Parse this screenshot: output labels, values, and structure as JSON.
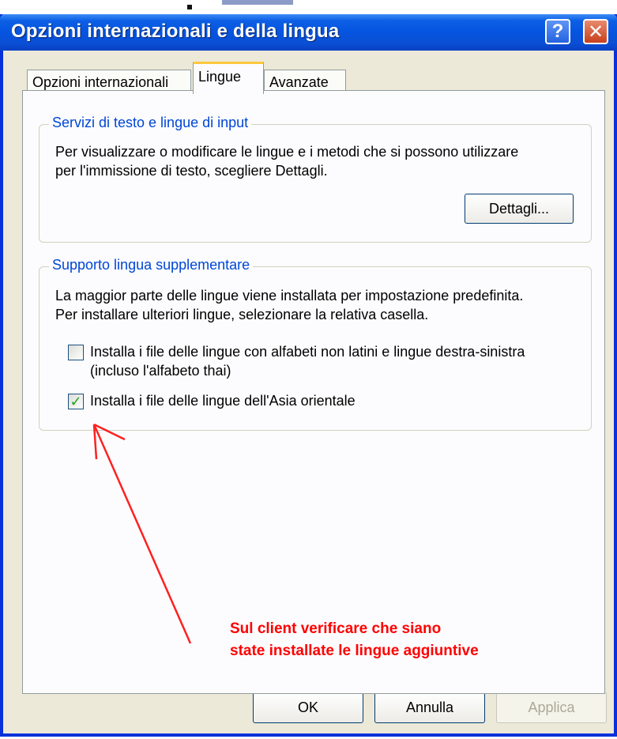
{
  "window": {
    "title": "Opzioni internazionali e della lingua",
    "help_glyph": "?",
    "close_glyph": "✕"
  },
  "tabs": [
    {
      "label": "Opzioni internazionali",
      "active": false
    },
    {
      "label": "Lingue",
      "active": true
    },
    {
      "label": "Avanzate",
      "active": false
    }
  ],
  "group1": {
    "legend": "Servizi di testo e lingue di input",
    "text_line1": "Per visualizzare o modificare le lingue e i metodi che si possono utilizzare",
    "text_line2": "per l'immissione di testo, scegliere Dettagli.",
    "details_button": "Dettagli..."
  },
  "group2": {
    "legend": "Supporto lingua supplementare",
    "text_line1": "La maggior parte delle lingue viene installata per impostazione predefinita.",
    "text_line2": "Per installare ulteriori lingue, selezionare la relativa casella.",
    "checkbox1_line1": "Installa i file delle lingue con alfabeti non latini e lingue destra-sinistra",
    "checkbox1_line2": "(incluso l'alfabeto thai)",
    "checkbox1_checked": false,
    "checkbox2_label": "Installa i file delle lingue dell'Asia orientale",
    "checkbox2_checked": true,
    "check_glyph": "✓"
  },
  "annotation": {
    "line1": "Sul client verificare che siano",
    "line2": "state installate le lingue aggiuntive",
    "color": "#ff0000"
  },
  "buttons": {
    "ok": "OK",
    "cancel": "Annulla",
    "apply": "Applica"
  },
  "colors": {
    "titlebar": "#0654e0",
    "dialog_bg": "#ece9d8",
    "legend": "#0046d5",
    "tab_highlight": "#ffc83c"
  }
}
